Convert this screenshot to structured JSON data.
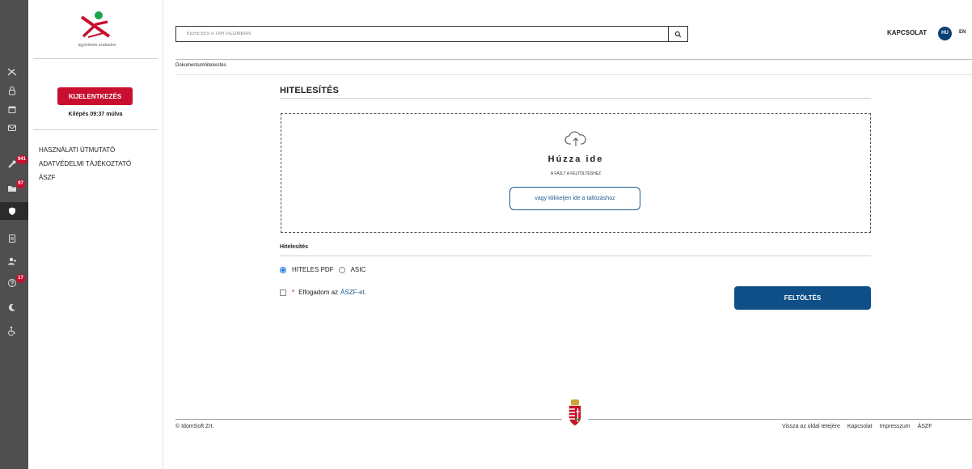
{
  "side": {
    "logo_text": "ügyintézés szabadon",
    "logout_label": "Kijelentkezés",
    "logout_timer": "Kilépés 09:37 múlva",
    "links": [
      "Használati útmutató",
      "Adatvédelmi tájékoztató",
      "ÁSZF"
    ]
  },
  "rail": {
    "badges": {
      "tools": "941",
      "inbox": "97",
      "help": "17"
    },
    "icons": [
      "agency-logo-icon",
      "lock-icon",
      "calendar-icon",
      "mail-icon",
      "wrench-icon",
      "folder-icon",
      "shield-icon",
      "document-icon",
      "user-add-icon",
      "help-icon",
      "moon-icon",
      "accessibility-icon"
    ]
  },
  "header": {
    "search_placeholder": "KERESÉS A TARTALOMBAN",
    "contact_label": "KAPCSOLAT",
    "lang_active": "HU",
    "lang_other": "EN"
  },
  "breadcrumb": "Dokumentumhitelesítés",
  "main": {
    "title": "HITELESÍTÉS",
    "drop_title": "Húzza ide",
    "drop_subtitle": "a fájlt a feltöltéshez",
    "browse_label": "vagy klikkeljen ide a tallózáshoz",
    "auth_label": "Hitelesítés",
    "options": [
      "HITELES PDF",
      "ASIC"
    ],
    "selected_option": "HITELES PDF",
    "terms_prefix": "Elfogadom az",
    "terms_link": "ÁSZF-et.",
    "terms_required_mark": "*",
    "upload_label": "Feltöltés"
  },
  "footer": {
    "copyright": "© IdomSoft Zrt.",
    "links": [
      "Vissza az oldal tetejére",
      "Kapcsolat",
      "Impresszum",
      "ÁSZF"
    ]
  },
  "colors": {
    "accent_red": "#c8102e",
    "primary_blue": "#0d4f86",
    "rail_bg": "#4f4f4f"
  }
}
